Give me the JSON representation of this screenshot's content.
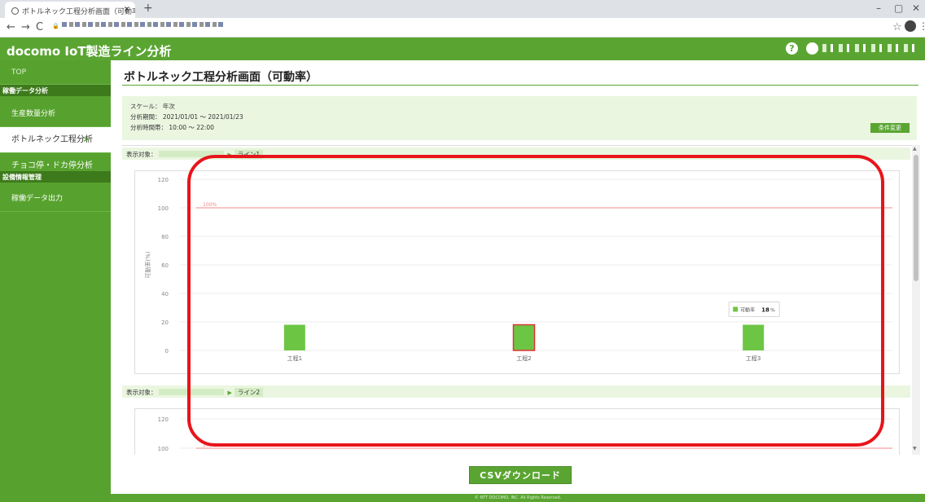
{
  "browser": {
    "tab_title": "ボトルネック工程分析画面（可動率",
    "tab_close": "×",
    "new_tab": "+",
    "url_prefix": "🔒",
    "win_min": "–",
    "win_max": "▢",
    "win_close": "✕",
    "nav_back": "←",
    "nav_forward": "→",
    "nav_reload": "C",
    "star": "☆",
    "menu": "⋮"
  },
  "header": {
    "app_title": "docomo IoT製造ライン分析",
    "help": "?"
  },
  "sidebar": {
    "top": "TOP",
    "section1": "稼働データ分析",
    "items": [
      {
        "label": "生産数量分析"
      },
      {
        "label": "ボトルネック工程分析",
        "chevron": ">"
      },
      {
        "label": "チョコ停・ドカ停分析"
      }
    ],
    "section2": "設備情報管理",
    "export": "稼働データ出力"
  },
  "main": {
    "page_title": "ボトルネック工程分析画面（可動率）",
    "conditions": {
      "scale": "スケール： 年次",
      "period": "分析期間： 2021/01/01 ～ 2021/01/23",
      "time": "分析時間帯： 10:00 ～ 22:00",
      "change_button": "条件変更"
    },
    "sections": [
      {
        "label": "表示対象：",
        "line": "ライン1"
      },
      {
        "label": "表示対象：",
        "line": "ライン2"
      }
    ],
    "csv_button": "CSVダウンロード"
  },
  "footer": {
    "text": "© NTT DOCOMO, INC. All Rights Reserved."
  },
  "chart_data": [
    {
      "type": "bar",
      "categories": [
        "工程1",
        "工程2",
        "工程3"
      ],
      "values": [
        18,
        18,
        18
      ],
      "ylabel": "可動率(%)",
      "ylim": [
        0,
        120
      ],
      "yticks": [
        0,
        20,
        40,
        60,
        80,
        100,
        120
      ],
      "reference_line": {
        "value": 100,
        "label": "100%",
        "color": "#f08a8a"
      },
      "bar_color": "#6cc644",
      "highlighted_category": "工程2",
      "highlight_border": "#e23232",
      "tooltip": {
        "category": "工程3",
        "series": "可動率",
        "value": "18",
        "unit": "%"
      },
      "grid": true
    },
    {
      "type": "bar",
      "ylim": [
        0,
        120
      ],
      "yticks": [
        100,
        120
      ],
      "reference_line": {
        "value": 100,
        "label": "100%",
        "color": "#f08a8a"
      }
    }
  ],
  "colors": {
    "brand": "#5aa532",
    "annotation": "#e8141b"
  }
}
